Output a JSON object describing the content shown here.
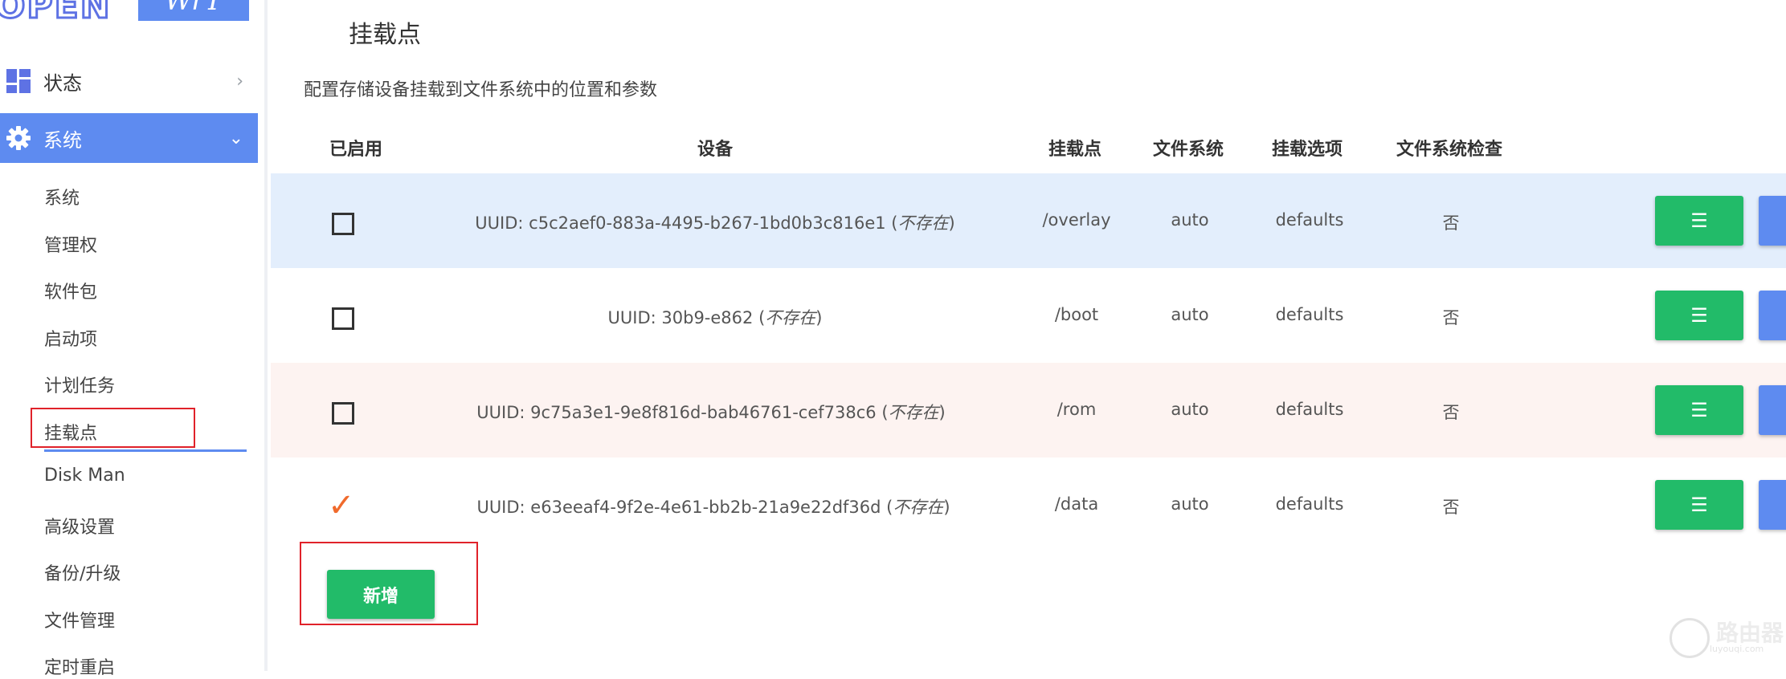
{
  "sidebar": {
    "logo_open": "OPEN",
    "logo_wrt": "WrT",
    "menu_status": "状态",
    "menu_system": "系统",
    "sub_items": [
      "系统",
      "管理权",
      "软件包",
      "启动项",
      "计划任务",
      "挂载点",
      "Disk Man",
      "高级设置",
      "备份/升级",
      "文件管理",
      "定时重启"
    ]
  },
  "page": {
    "title": "挂载点",
    "description": "配置存储设备挂载到文件系统中的位置和参数"
  },
  "table": {
    "headers": [
      "已启用",
      "设备",
      "挂载点",
      "文件系统",
      "挂载选项",
      "文件系统检查"
    ],
    "rows": [
      {
        "enabled": false,
        "device": "UUID: c5c2aef0-883a-4495-b267-1bd0b3c816e1",
        "missing": "不存在",
        "mount": "/overlay",
        "fs": "auto",
        "options": "defaults",
        "check": "否",
        "edit_label": "☰"
      },
      {
        "enabled": false,
        "device": "UUID: 30b9-e862",
        "missing": "不存在",
        "mount": "/boot",
        "fs": "auto",
        "options": "defaults",
        "check": "否",
        "edit_label": "☰"
      },
      {
        "enabled": false,
        "device": "UUID: 9c75a3e1-9e8f816d-bab46761-cef738c6",
        "missing": "不存在",
        "mount": "/rom",
        "fs": "auto",
        "options": "defaults",
        "check": "否",
        "edit_label": "☰"
      },
      {
        "enabled": true,
        "device": "UUID: e63eeaf4-9f2e-4e61-bb2b-21a9e22df36d",
        "missing": "不存在",
        "mount": "/data",
        "fs": "auto",
        "options": "defaults",
        "check": "否",
        "edit_label": "☰"
      }
    ]
  },
  "add_button": "新增",
  "watermark": {
    "text": "路由器",
    "sub": "luyouqi.com"
  },
  "colors": {
    "accent": "#5e8bf0",
    "green": "#22bb69",
    "highlight": "#e0222a",
    "check": "#f06a2c"
  }
}
